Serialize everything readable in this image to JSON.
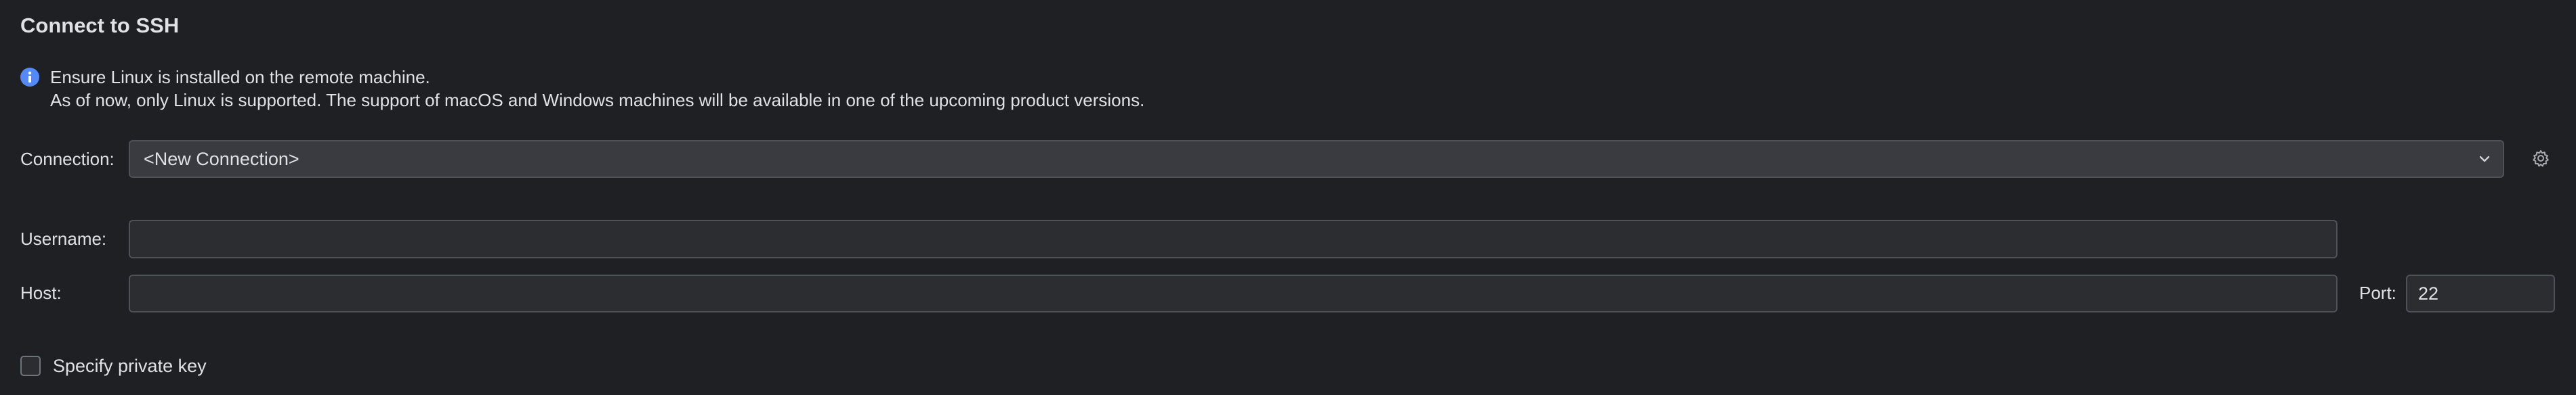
{
  "dialog": {
    "title": "Connect to SSH"
  },
  "info": {
    "icon": "info-icon",
    "icon_color": "#548af7",
    "line1": "Ensure Linux is installed on the remote machine.",
    "line2": "As of now, only Linux is supported. The support of macOS and Windows machines will be available in one of the upcoming product versions."
  },
  "connection": {
    "label": "Connection:",
    "selected": "<New Connection>",
    "dropdown_icon": "chevron-down-icon",
    "settings_icon": "gear-icon"
  },
  "username": {
    "label": "Username:",
    "value": ""
  },
  "host": {
    "label": "Host:",
    "value": ""
  },
  "port": {
    "label": "Port:",
    "value": "22"
  },
  "private_key": {
    "label": "Specify private key",
    "checked": false
  },
  "colors": {
    "background": "#1f2023",
    "text": "#dfe1e5",
    "field_background": "#2b2d30",
    "field_border": "#4e5157",
    "accent": "#548af7"
  }
}
